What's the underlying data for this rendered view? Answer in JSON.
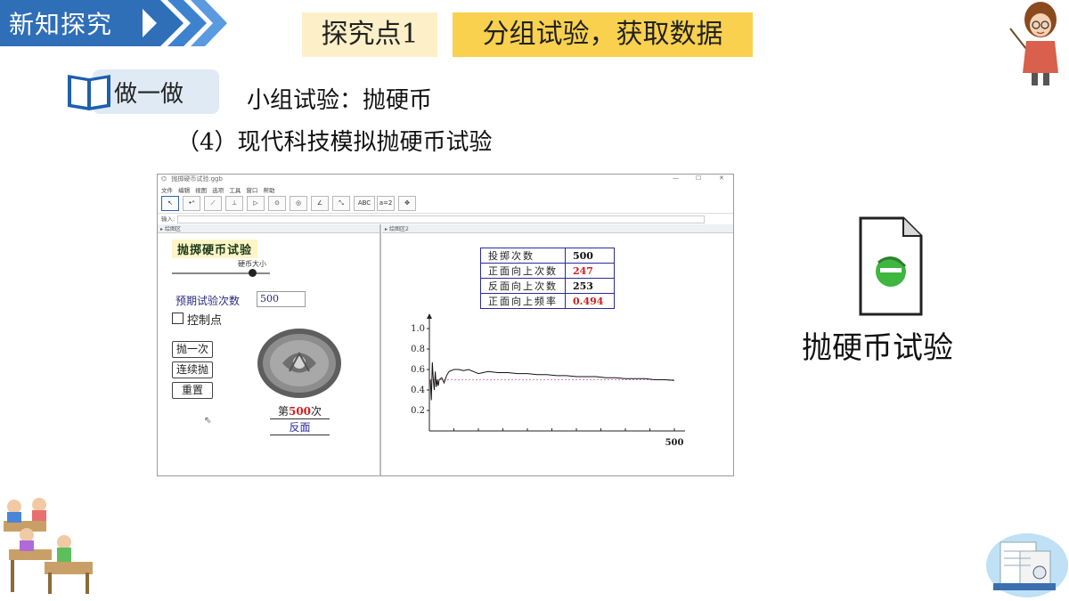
{
  "header": {
    "banner_title": "新知探究",
    "explore_point": "探究点1",
    "explore_title": "分组试验，获取数据"
  },
  "section": {
    "tag_label": "做一做",
    "subtitle": "小组试验：抛硬币",
    "step": "（4）现代科技模拟抛硬币试验"
  },
  "app": {
    "window_title": "抛掷硬币试验.ggb",
    "menu": [
      "文件",
      "编辑",
      "视图",
      "选项",
      "工具",
      "窗口",
      "帮助"
    ],
    "toolbar_text_button": "ABC",
    "toolbar_slider_button": "a=2",
    "input_label": "输入:",
    "pane1_title": "绘图区",
    "pane2_title": "绘图区2",
    "left": {
      "title": "抛掷硬币试验",
      "slider_label": "硬币大小",
      "expected_label": "预期试验次数",
      "expected_value": "500",
      "control_points_label": "控制点",
      "buttons": [
        "抛一次",
        "连续抛",
        "重置"
      ],
      "count_prefix": "第",
      "count_value": "500",
      "count_suffix": "次",
      "face_result": "反面"
    },
    "stats": [
      {
        "label": "投掷次数",
        "value": "500",
        "highlight": false
      },
      {
        "label": "正面向上次数",
        "value": "247",
        "highlight": true
      },
      {
        "label": "反面向上次数",
        "value": "253",
        "highlight": false
      },
      {
        "label": "正面向上频率",
        "value": "0.494",
        "highlight": true
      }
    ]
  },
  "chart_data": {
    "type": "line",
    "title": "",
    "xlabel": "",
    "ylabel": "",
    "xlim": [
      0,
      500
    ],
    "ylim": [
      0,
      1.0
    ],
    "y_ticks": [
      "0.2",
      "0.4",
      "0.6",
      "0.8",
      "1.0"
    ],
    "x_tick_label": "500",
    "reference_line_y": 0.5,
    "series": [
      {
        "color": "#111111",
        "x": [
          2,
          4,
          6,
          8,
          10,
          12,
          14,
          16,
          18,
          20,
          25,
          30,
          35,
          40,
          50,
          60,
          70,
          80,
          90,
          100,
          120,
          140,
          160,
          180,
          200,
          220,
          240,
          260,
          280,
          300,
          320,
          340,
          360,
          380,
          400,
          420,
          440,
          460,
          480,
          500
        ],
        "y": [
          0.5,
          0.3,
          0.67,
          0.5,
          0.4,
          0.58,
          0.43,
          0.5,
          0.44,
          0.5,
          0.52,
          0.47,
          0.54,
          0.58,
          0.6,
          0.6,
          0.59,
          0.6,
          0.58,
          0.56,
          0.58,
          0.57,
          0.57,
          0.56,
          0.56,
          0.55,
          0.55,
          0.54,
          0.54,
          0.53,
          0.53,
          0.53,
          0.52,
          0.52,
          0.51,
          0.51,
          0.51,
          0.5,
          0.5,
          0.494
        ]
      }
    ]
  },
  "file": {
    "label": "抛硬币试验"
  }
}
